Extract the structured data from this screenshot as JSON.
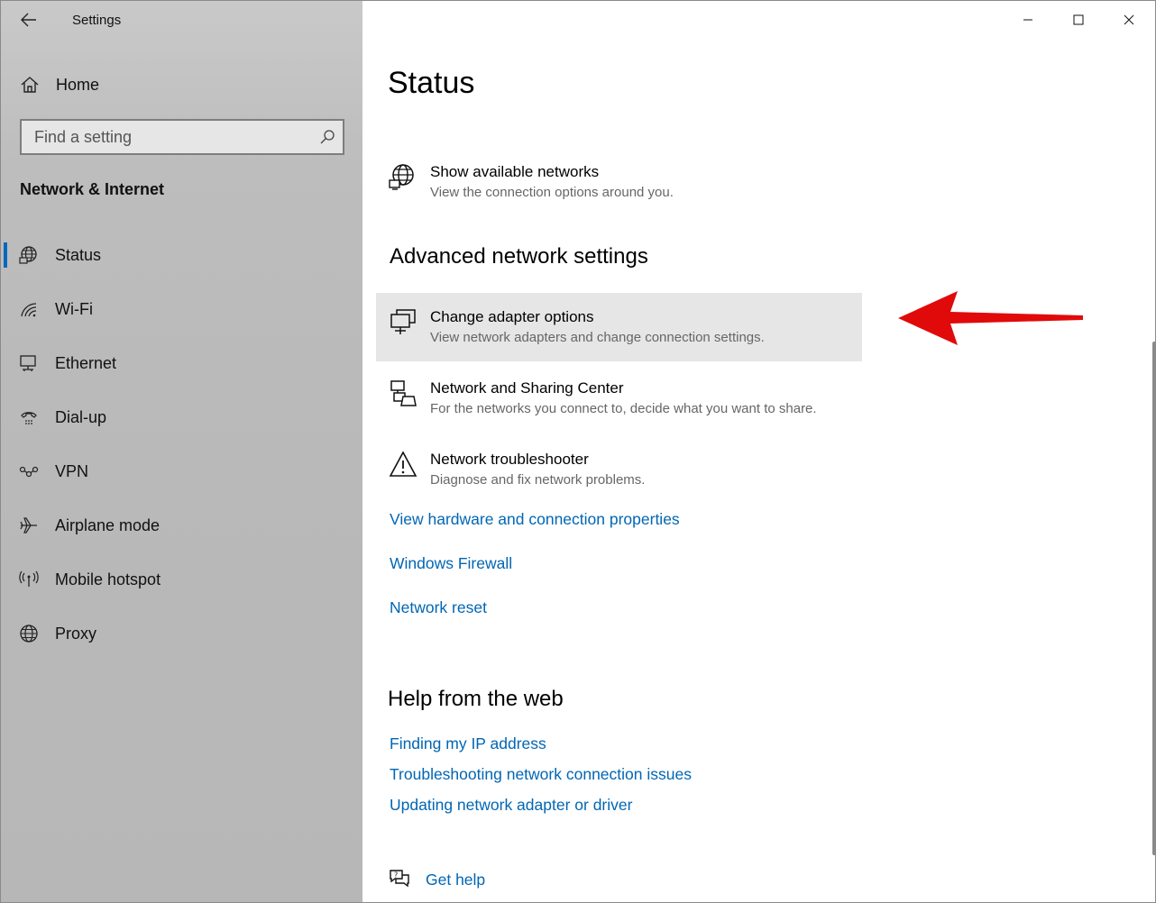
{
  "app": {
    "title": "Settings"
  },
  "sidebar": {
    "home_label": "Home",
    "search_placeholder": "Find a setting",
    "section_title": "Network & Internet",
    "items": [
      {
        "label": "Status",
        "icon": "globe-status-icon",
        "selected": true
      },
      {
        "label": "Wi-Fi",
        "icon": "wifi-icon",
        "selected": false
      },
      {
        "label": "Ethernet",
        "icon": "ethernet-icon",
        "selected": false
      },
      {
        "label": "Dial-up",
        "icon": "dialup-icon",
        "selected": false
      },
      {
        "label": "VPN",
        "icon": "vpn-icon",
        "selected": false
      },
      {
        "label": "Airplane mode",
        "icon": "airplane-icon",
        "selected": false
      },
      {
        "label": "Mobile hotspot",
        "icon": "hotspot-icon",
        "selected": false
      },
      {
        "label": "Proxy",
        "icon": "globe-icon",
        "selected": false
      }
    ]
  },
  "main": {
    "title": "Status",
    "show_networks": {
      "title": "Show available networks",
      "desc": "View the connection options around you."
    },
    "advanced_heading": "Advanced network settings",
    "advanced_items": [
      {
        "title": "Change adapter options",
        "desc": "View network adapters and change connection settings.",
        "icon": "adapter-icon"
      },
      {
        "title": "Network and Sharing Center",
        "desc": "For the networks you connect to, decide what you want to share.",
        "icon": "sharing-center-icon"
      },
      {
        "title": "Network troubleshooter",
        "desc": "Diagnose and fix network problems.",
        "icon": "warning-icon"
      }
    ],
    "links": [
      "View hardware and connection properties",
      "Windows Firewall",
      "Network reset"
    ],
    "help_heading": "Help from the web",
    "help_links": [
      "Finding my IP address",
      "Troubleshooting network connection issues",
      "Updating network adapter or driver"
    ],
    "get_help": "Get help"
  },
  "colors": {
    "accent": "#0067c0",
    "link": "#0066b4",
    "annotation_arrow": "#e10a0a",
    "hover_row": "#e6e6e6"
  }
}
